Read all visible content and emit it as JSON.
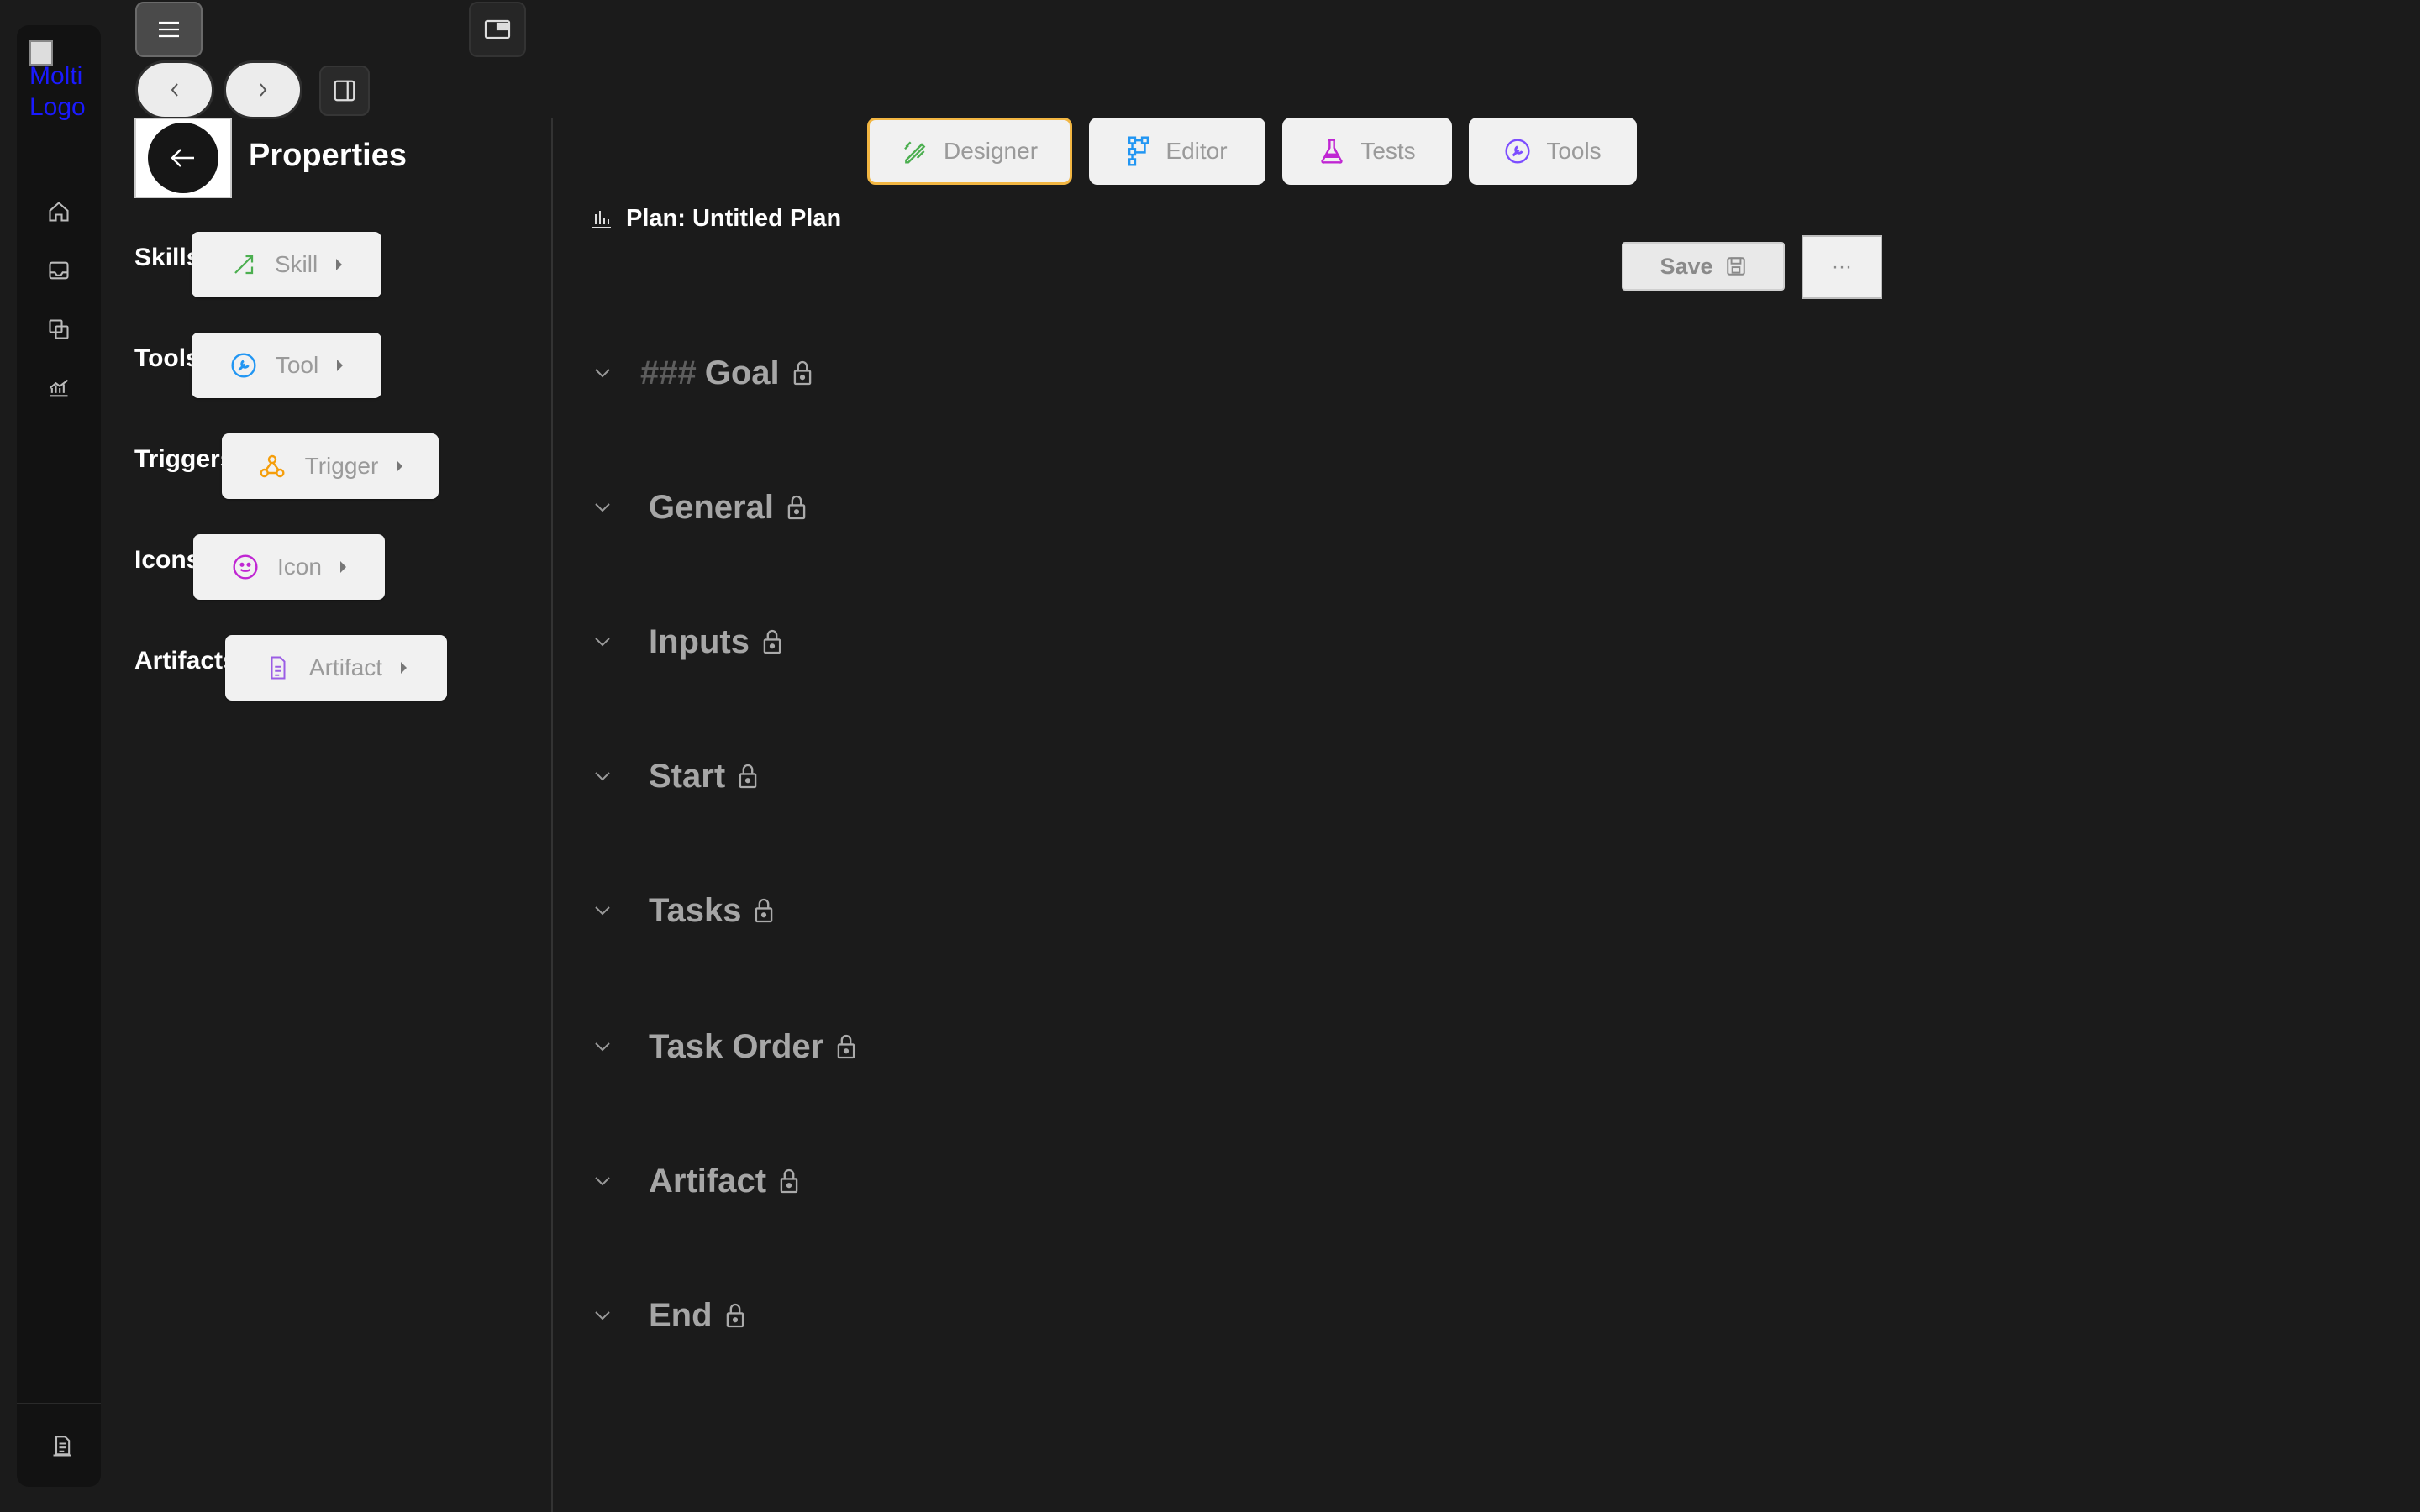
{
  "rail": {
    "logo_alt": "Molti Logo",
    "nav": [
      {
        "name": "home",
        "icon": "home-icon"
      },
      {
        "name": "inbox",
        "icon": "inbox-icon"
      },
      {
        "name": "copies",
        "icon": "layers-icon"
      },
      {
        "name": "analytics",
        "icon": "chart-icon"
      }
    ],
    "bottom_icon": "document-icon"
  },
  "panel": {
    "title": "Properties",
    "properties": [
      {
        "label": "Skills",
        "button": "Skill",
        "icon": "skill-icon",
        "color": "#4caf50"
      },
      {
        "label": "Tools",
        "button": "Tool",
        "icon": "wrench-icon",
        "color": "#2196f3"
      },
      {
        "label": "Triggers",
        "button": "Trigger",
        "icon": "webhook-icon",
        "color": "#f59e0b"
      },
      {
        "label": "Icons",
        "button": "Icon",
        "icon": "smiley-icon",
        "color": "#c026d3"
      },
      {
        "label": "Artifacts",
        "button": "Artifact",
        "icon": "file-icon",
        "color": "#9b5de5"
      }
    ]
  },
  "tabs": [
    {
      "label": "Designer",
      "active": true,
      "icon": "designer-icon",
      "color": "#4caf50"
    },
    {
      "label": "Editor",
      "active": false,
      "icon": "flow-icon",
      "color": "#2196f3"
    },
    {
      "label": "Tests",
      "active": false,
      "icon": "flask-icon",
      "color": "#c026d3"
    },
    {
      "label": "Tools",
      "active": false,
      "icon": "wrench-icon",
      "color": "#7c4dff"
    }
  ],
  "plan": {
    "title": "Plan: Untitled Plan",
    "save_label": "Save",
    "more_label": "···"
  },
  "sections": [
    {
      "prefix": "###",
      "title": "Goal"
    },
    {
      "title": "General"
    },
    {
      "title": "Inputs"
    },
    {
      "title": "Start"
    },
    {
      "title": "Tasks"
    },
    {
      "title": "Task Order"
    },
    {
      "title": "Artifact"
    },
    {
      "title": "End"
    }
  ]
}
